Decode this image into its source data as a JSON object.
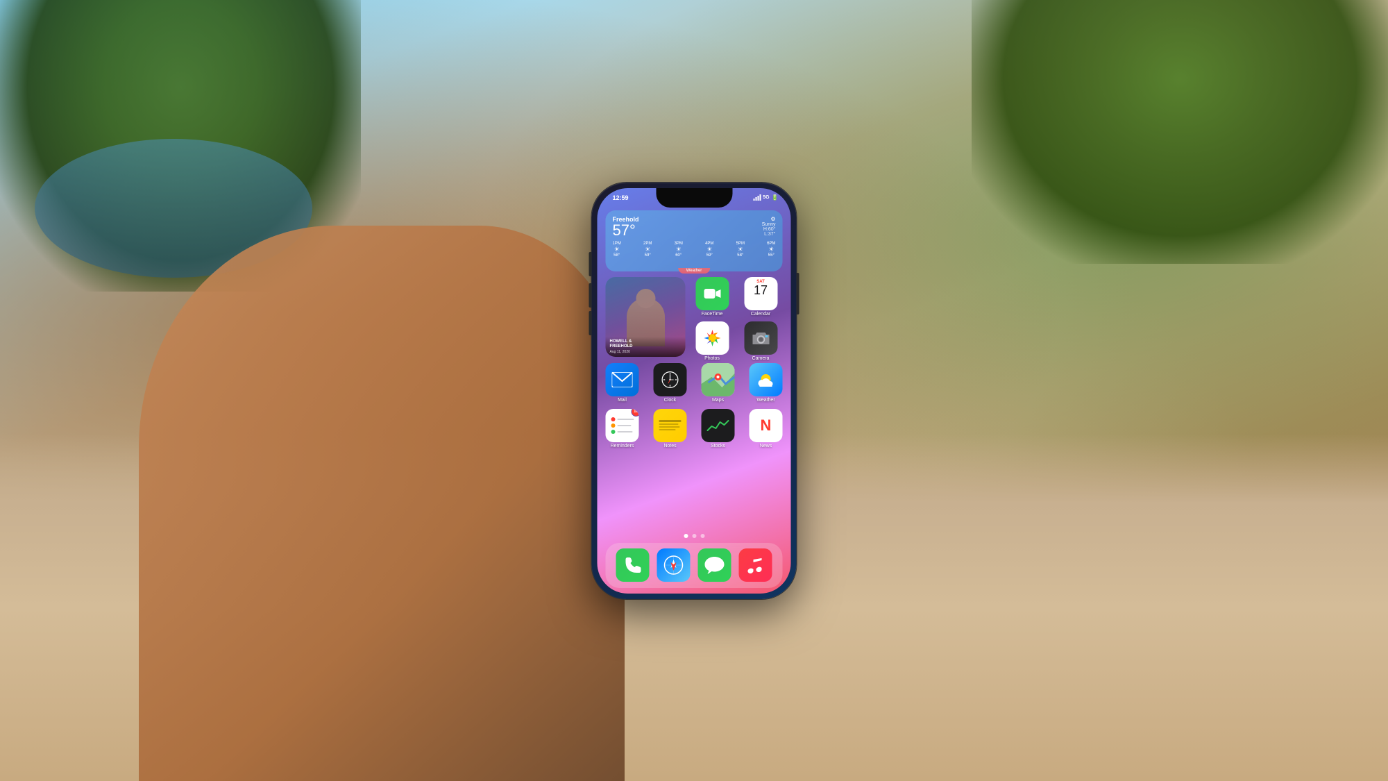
{
  "background": {
    "description": "Outdoor nature scene with trees and sandy path, person holding iPhone"
  },
  "phone": {
    "status_bar": {
      "time": "12:59",
      "signal": "5G",
      "battery": "full"
    },
    "weather_widget": {
      "city": "Freehold",
      "temperature": "57°",
      "condition": "Sunny",
      "high": "H:60°",
      "low": "L:37°",
      "hours": [
        {
          "time": "1PM",
          "icon": "☀",
          "temp": "58°"
        },
        {
          "time": "2PM",
          "icon": "☀",
          "temp": "59°"
        },
        {
          "time": "3PM",
          "icon": "☀",
          "temp": "60°"
        },
        {
          "time": "4PM",
          "icon": "☀",
          "temp": "59°"
        },
        {
          "time": "5PM",
          "icon": "☀",
          "temp": "58°"
        },
        {
          "time": "6PM",
          "icon": "☀",
          "temp": "55°"
        }
      ],
      "label": "Weather"
    },
    "photo_widget": {
      "title": "HOWELL &\nFREEHOLD",
      "date": "Aug 11, 2020"
    },
    "apps": {
      "row0_2x2": [
        {
          "id": "facetime",
          "label": "FaceTime",
          "icon_type": "facetime"
        },
        {
          "id": "calendar",
          "label": "Calendar",
          "icon_type": "calendar",
          "month": "SAT",
          "day": "17"
        },
        {
          "id": "photos",
          "label": "Photos",
          "icon_type": "photos"
        },
        {
          "id": "camera",
          "label": "Camera",
          "icon_type": "camera"
        }
      ],
      "row1": [
        {
          "id": "mail",
          "label": "Mail",
          "icon_type": "mail"
        },
        {
          "id": "clock",
          "label": "Clock",
          "icon_type": "clock"
        },
        {
          "id": "maps",
          "label": "Maps",
          "icon_type": "maps"
        },
        {
          "id": "weather",
          "label": "Weather",
          "icon_type": "weather"
        }
      ],
      "row2": [
        {
          "id": "reminders",
          "label": "Reminders",
          "icon_type": "reminders",
          "badge": "10"
        },
        {
          "id": "notes",
          "label": "Notes",
          "icon_type": "notes"
        },
        {
          "id": "stocks",
          "label": "Stocks",
          "icon_type": "stocks"
        },
        {
          "id": "news",
          "label": "News",
          "icon_type": "news"
        }
      ]
    },
    "dock": [
      {
        "id": "phone",
        "label": "Phone",
        "icon_type": "phone"
      },
      {
        "id": "safari",
        "label": "Safari",
        "icon_type": "safari"
      },
      {
        "id": "messages",
        "label": "Messages",
        "icon_type": "messages"
      },
      {
        "id": "music",
        "label": "Music",
        "icon_type": "music"
      }
    ],
    "page_dots": [
      {
        "active": true
      },
      {
        "active": false
      },
      {
        "active": false
      }
    ]
  }
}
